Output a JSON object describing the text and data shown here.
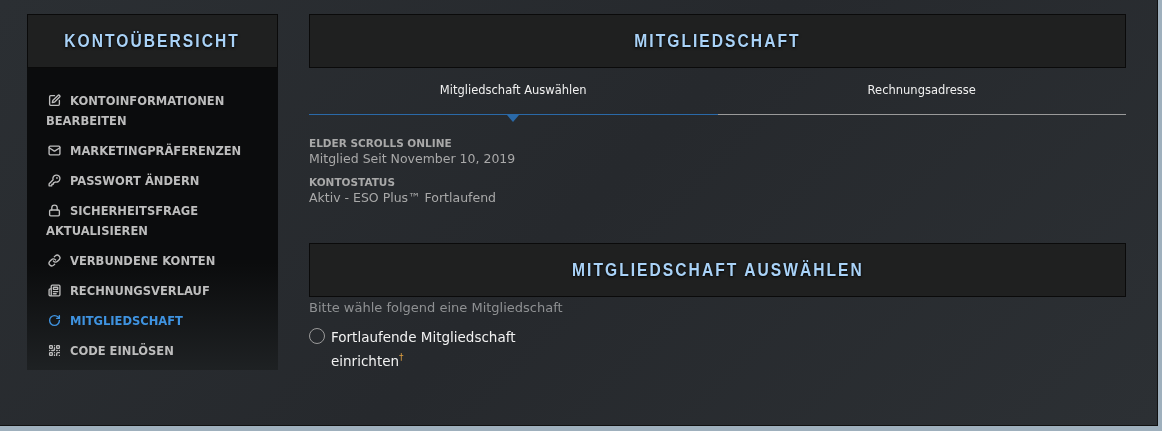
{
  "sidebar": {
    "title": "KONTOÜBERSICHT",
    "items": [
      {
        "label": "KONTOINFORMATIONEN BEARBEITEN",
        "selected": false
      },
      {
        "label": "MARKETINGPRÄFERENZEN",
        "selected": false
      },
      {
        "label": "PASSWORT ÄNDERN",
        "selected": false
      },
      {
        "label": "SICHERHEITSFRAGE AKTUALISIEREN",
        "selected": false
      },
      {
        "label": "VERBUNDENE KONTEN",
        "selected": false
      },
      {
        "label": "RECHNUNGSVERLAUF",
        "selected": false
      },
      {
        "label": "MITGLIEDSCHAFT",
        "selected": true
      },
      {
        "label": "CODE EINLÖSEN",
        "selected": false
      }
    ]
  },
  "main": {
    "title": "MITGLIEDSCHAFT",
    "tabs": [
      {
        "label": "Mitgliedschaft Auswählen",
        "selected": true
      },
      {
        "label": "Rechnungsadresse",
        "selected": false
      }
    ],
    "info": [
      {
        "label": "ELDER SCROLLS ONLINE",
        "value": "Mitglied Seit November 10, 2019"
      },
      {
        "label": "KONTOSTATUS",
        "value": "Aktiv - ESO Plus™ Fortlaufend"
      }
    ],
    "section_title": "MITGLIEDSCHAFT AUSWÄHLEN",
    "prompt": "Bitte wähle folgend eine Mitgliedschaft",
    "options": [
      {
        "label": "Fortlaufende Mitgliedschaft einrichten$^{†}$",
        "selected": false
      }
    ]
  }
}
